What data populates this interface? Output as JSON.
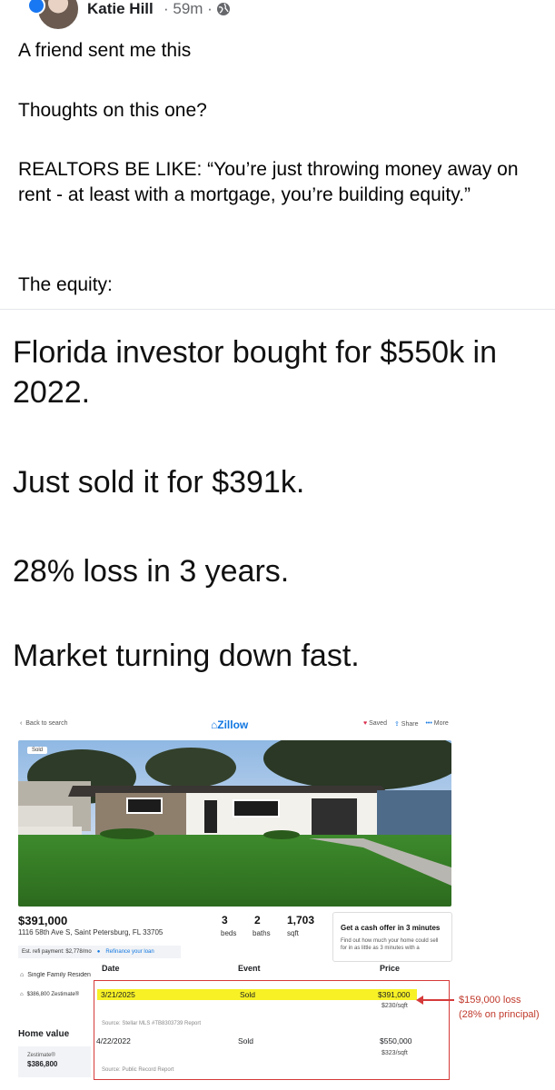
{
  "header": {
    "author": "Katie Hill",
    "time": "· 59m ·"
  },
  "post": {
    "line1": "A friend sent me this",
    "line2": "Thoughts on this one?",
    "line3": "REALTORS BE LIKE: “You’re just throwing money away on rent - at least with a mortgage, you’re building equity.”",
    "line4": "The equity:"
  },
  "meme": {
    "l1": "Florida investor bought for $550k in 2022.",
    "l2": "Just sold it for $391k.",
    "l3": "28% loss in 3 years.",
    "l4": "Market turning down fast."
  },
  "zillow": {
    "back": "Back to search",
    "logo": "Zillow",
    "saved": "Saved",
    "share": "Share",
    "more": "More",
    "sold_badge": "Sold",
    "price": "$391,000",
    "address": "1116 58th Ave S, Saint Petersburg, FL 33705",
    "beds": "3",
    "beds_label": "beds",
    "baths": "2",
    "baths_label": "baths",
    "sqft": "1,703",
    "sqft_label": "sqft",
    "refi": "Est. refi payment: $2,778/mo",
    "refi_link": "Refinance your loan",
    "cash_offer": "Get a cash offer in 3 minutes",
    "cash_desc": "Find out how much your home could sell for in as little as 3 minutes with a",
    "type": "Single Family Residen",
    "zestimate_line": "$386,800 Zestimate®",
    "home_value": "Home value",
    "zestimate_label": "Zestimate®",
    "zestimate_value": "$386,800",
    "history": {
      "headers": [
        "Date",
        "Event",
        "Price"
      ],
      "rows": [
        {
          "date": "3/21/2025",
          "event": "Sold",
          "price": "$391,000",
          "per": "$230/sqft",
          "source": "Source: Stellar MLS #TB8303739 Report"
        },
        {
          "date": "4/22/2022",
          "event": "Sold",
          "price": "$550,000",
          "per": "$323/sqft",
          "source": "Source: Public Record Report"
        }
      ]
    },
    "annotation_1": "$159,000 loss",
    "annotation_2": "(28% on principal)"
  }
}
